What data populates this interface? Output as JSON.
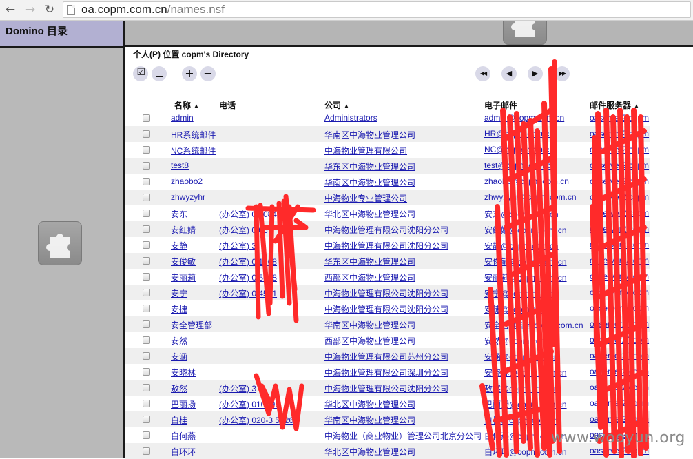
{
  "browser": {
    "url_domain": "oa.copm.com.cn",
    "url_path": "/names.nsf"
  },
  "left_frame": {
    "title": "Domino 目录"
  },
  "view": {
    "title": "个人(P) 位置 copm's Directory"
  },
  "toolbar": {
    "select_all": "☑",
    "deselect_all": "☐",
    "expand": "+",
    "collapse": "−",
    "first": "◀◀",
    "prev": "◀",
    "next": "▶",
    "last": "▶▶"
  },
  "columns": {
    "name": "名称",
    "phone": "电话",
    "company": "公司",
    "email": "电子邮件",
    "server": "邮件服务器",
    "sort_glyph": "▲"
  },
  "rows": [
    {
      "name": "admin",
      "phone": "",
      "company": "Administrators",
      "email": "admin@copm.com.cn",
      "server": "oaserver2/copm"
    },
    {
      "name": "HR系统邮件",
      "phone": "",
      "company": "华南区中海物业管理公司",
      "email": "HR@copm.com.cn",
      "server": "oaserver2/copm"
    },
    {
      "name": "NC系统邮件",
      "phone": "",
      "company": "中海物业管理有限公司",
      "email": "NC@copm.com.cn",
      "server": "oaserver2/copm"
    },
    {
      "name": "test8",
      "phone": "",
      "company": "华东区中海物业管理公司",
      "email": "test@copm.com.cn",
      "server": "oaserver2/copm"
    },
    {
      "name": "zhaobo2",
      "phone": "",
      "company": "华南区中海物业管理公司",
      "email": "zhaobo@copm.com.cn",
      "server": "oaserver2/copm"
    },
    {
      "name": "zhwyzyhr",
      "phone": "",
      "company": "中海物业专业管理公司",
      "email": "zhwyzyhr@copm.com.cn",
      "server": "oaserver2/copm"
    },
    {
      "name": "安东",
      "phone": "(办公室) 0     8084",
      "company": "华北区中海物业管理公司",
      "email": "安东@copm.com.cn",
      "server": "oaserver2/copm"
    },
    {
      "name": "安红婧",
      "phone": "(办公室) 0        06",
      "company": "中海物业管理有限公司沈阳分公司",
      "email": "安红婧@copm.com.cn",
      "server": "oaserver2/copm"
    },
    {
      "name": "安静",
      "phone": "(办公室) 3",
      "company": "中海物业管理有限公司沈阳分公司",
      "email": "安静@copm.com.cn",
      "server": "oaserver2/copm"
    },
    {
      "name": "安俊敏",
      "phone": "(办公室) 0       1908",
      "company": "华东区中海物业管理公司",
      "email": "安俊敏@copm.com.cn",
      "server": "oaserver2/copm"
    },
    {
      "name": "安丽莉",
      "phone": "(办公室) 0       5008",
      "company": "西部区中海物业管理公司",
      "email": "安丽莉@copm.com.cn",
      "server": "oaserver2/copm"
    },
    {
      "name": "安宁",
      "phone": "(办公室) 0     4521",
      "company": "中海物业管理有限公司沈阳分公司",
      "email": "安宁@copm.com.cn",
      "server": "oaserver2/copm"
    },
    {
      "name": "安捷",
      "phone": "",
      "company": "中海物业管理有限公司沈阳分公司",
      "email": "安捷@copm.com.cn",
      "server": "oaserver2/copm"
    },
    {
      "name": "安全管理部",
      "phone": "",
      "company": "华南区中海物业管理公司",
      "email": "安全管理部@copm.com.cn",
      "server": "oaserver2/copm"
    },
    {
      "name": "安然",
      "phone": "",
      "company": "西部区中海物业管理公司",
      "email": "安然@copm.com.cn",
      "server": "oaserver2/copm"
    },
    {
      "name": "安涵",
      "phone": "",
      "company": "中海物业管理有限公司苏州分公司",
      "email": "安涵@copm.com.cn",
      "server": "oaserver2/copm"
    },
    {
      "name": "安晓林",
      "phone": "",
      "company": "中海物业管理有限公司深圳分公司",
      "email": "安晓林@copm.com.cn",
      "server": "oaserver2/copm"
    },
    {
      "name": "敖然",
      "phone": "(办公室) 3",
      "company": "中海物业管理有限公司沈阳分公司",
      "email": "敖然@copm.com.cn",
      "server": "oaserver2/copm"
    },
    {
      "name": "巴丽扬",
      "phone": "(办公室) 010-      99",
      "company": "华北区中海物业管理公司",
      "email": "巴丽扬@copm.com.cn",
      "server": "oaserver2/copm"
    },
    {
      "name": "白桂",
      "phone": "(办公室) 020-3   56266",
      "company": "华南区中海物业管理公司",
      "email": "白桂@copm.com.cn",
      "server": "oaserver2/copm"
    },
    {
      "name": "白何燕",
      "phone": "",
      "company": "中海物业（商业物业）管理公司北京分公司",
      "email": "白何燕@copm.com.cn",
      "server": "oaserver2/copm"
    },
    {
      "name": "白环环",
      "phone": "",
      "company": "华北区中海物业管理公司",
      "email": "白环环@copm.com.cn",
      "server": "oaserver2/copm"
    }
  ],
  "watermark": "www.wooyun.org",
  "colors": {
    "left_header_bg": "#b2b0d2",
    "frame_bg": "#b9b9b9",
    "link": "#1a1ab0",
    "scribble": "#ff2a2a",
    "row_alt": "#efefef"
  }
}
